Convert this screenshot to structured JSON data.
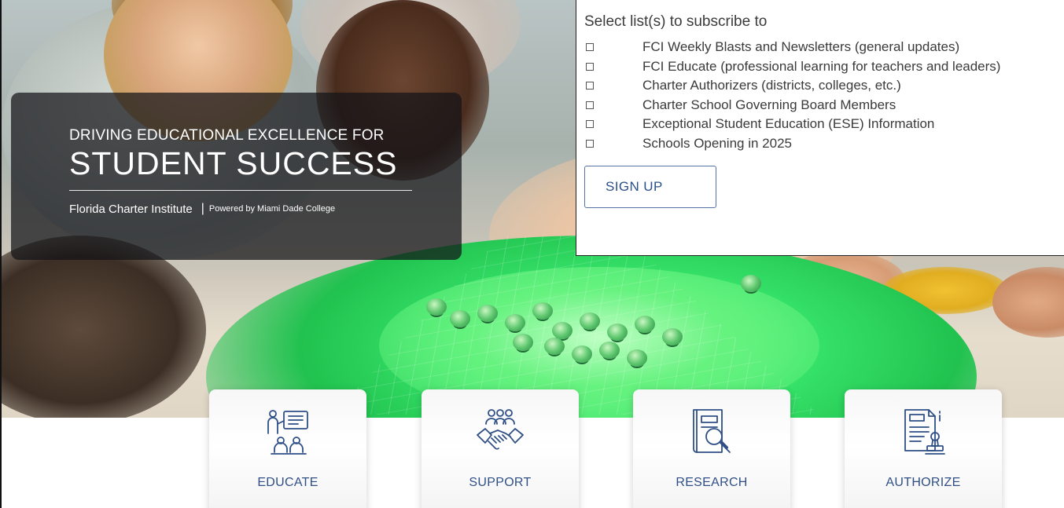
{
  "hero": {
    "kicker": "DRIVING EDUCATIONAL EXCELLENCE FOR",
    "headline": "STUDENT SUCCESS",
    "org_name": "Florida Charter Institute",
    "separator": "|",
    "powered_by": "Powered by Miami Dade College"
  },
  "subscribe": {
    "title": "Select list(s) to subscribe to",
    "lists": [
      {
        "label": "FCI Weekly Blasts and Newsletters (general updates)",
        "checked": false
      },
      {
        "label": "FCI Educate (professional learning for teachers and leaders)",
        "checked": false
      },
      {
        "label": "Charter Authorizers (districts, colleges, etc.)",
        "checked": false
      },
      {
        "label": "Charter School Governing Board Members",
        "checked": false
      },
      {
        "label": "Exceptional Student Education (ESE) Information",
        "checked": false
      },
      {
        "label": "Schools Opening in 2025",
        "checked": false
      }
    ],
    "signup_label": "SIGN UP"
  },
  "cards": [
    {
      "label": "EDUCATE",
      "icon": "teacher-presentation-icon"
    },
    {
      "label": "SUPPORT",
      "icon": "handshake-group-icon"
    },
    {
      "label": "RESEARCH",
      "icon": "book-magnifier-icon"
    },
    {
      "label": "AUTHORIZE",
      "icon": "document-stamp-icon"
    }
  ],
  "colors": {
    "accent_blue": "#2f4f86",
    "button_border": "#5573a8",
    "overlay": "#141418",
    "hologram_green": "#37e36a"
  }
}
